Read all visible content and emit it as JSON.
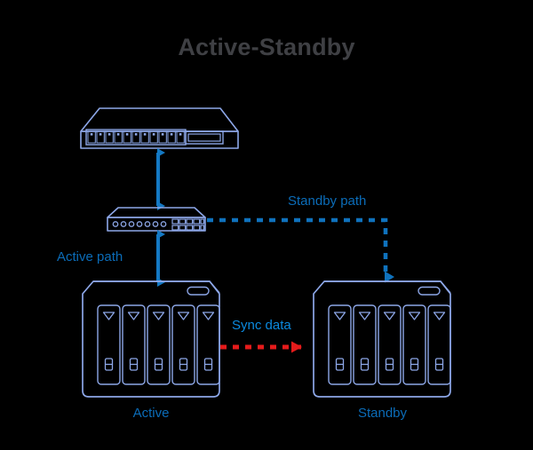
{
  "title": "Active-Standby",
  "colors": {
    "background": "#000000",
    "title_text": "#3f4044",
    "device_outline": "#8da7e8",
    "active_path": "#1479c4",
    "standby_path": "#0b6cb8",
    "sync_data": "#e51b1b",
    "label_blue": "#0b6cb8",
    "sync_label_blue": "#0b8ae0"
  },
  "labels": {
    "active_path": "Active path",
    "standby_path": "Standby path",
    "sync_data": "Sync data",
    "active": "Active",
    "standby": "Standby"
  },
  "devices": {
    "router": {
      "name": "Router",
      "port_count": 11,
      "has_display_panel": true
    },
    "switch": {
      "name": "Switch",
      "led_count": 7,
      "port_rows": 2,
      "port_columns": 5
    },
    "nas_active": {
      "name": "Active NAS",
      "bay_count": 5,
      "label": "Active"
    },
    "nas_standby": {
      "name": "Standby NAS",
      "bay_count": 5,
      "label": "Standby"
    }
  },
  "connections": [
    {
      "name": "router-to-switch",
      "style": "solid",
      "arrows": "double",
      "color": "#1479c4",
      "label": "Active path"
    },
    {
      "name": "switch-to-active-nas",
      "style": "solid",
      "arrows": "double",
      "color": "#1479c4",
      "label": "Active path"
    },
    {
      "name": "switch-to-standby-nas",
      "style": "dashed",
      "arrows": "single",
      "color": "#0b6cb8",
      "label": "Standby path"
    },
    {
      "name": "active-nas-to-standby-nas",
      "style": "dashed",
      "arrows": "single",
      "color": "#e51b1b",
      "label": "Sync data"
    }
  ]
}
